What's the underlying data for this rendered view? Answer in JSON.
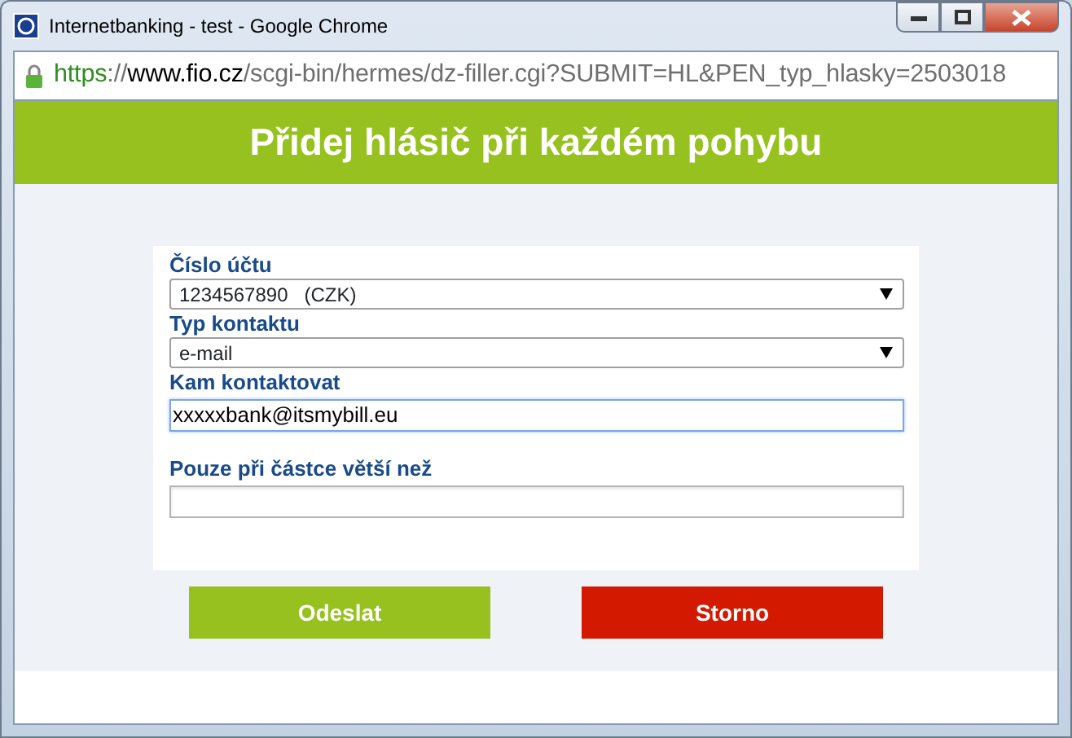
{
  "window": {
    "title": "Internetbanking -  test  - Google Chrome"
  },
  "address_bar": {
    "url": [
      {
        "kind": "scheme",
        "text": "https"
      },
      {
        "kind": "path",
        "text": "://"
      },
      {
        "kind": "host",
        "text": "www.fio.cz"
      },
      {
        "kind": "path",
        "text": "/scgi-bin/hermes/dz-filler.cgi?SUBMIT=HL&PEN_typ_hlasky=2503018"
      }
    ]
  },
  "header": {
    "title": "Přidej hlásič při každém pohybu"
  },
  "fields": [
    {
      "kind": "select",
      "label": "Číslo účtu",
      "value": "1234567890   (CZK)",
      "focused": false
    },
    {
      "kind": "select",
      "label": "Typ kontaktu",
      "value": "e-mail",
      "focused": false
    },
    {
      "kind": "input",
      "label": "Kam kontaktovat",
      "value": "xxxxxbank@itsmybill.eu",
      "focused": true
    },
    {
      "kind": "input",
      "label": "Pouze při částce větší než",
      "focused": false
    }
  ],
  "buttons": [
    {
      "kind": "submit",
      "label": "Odeslat"
    },
    {
      "kind": "cancel",
      "label": "Storno"
    }
  ]
}
